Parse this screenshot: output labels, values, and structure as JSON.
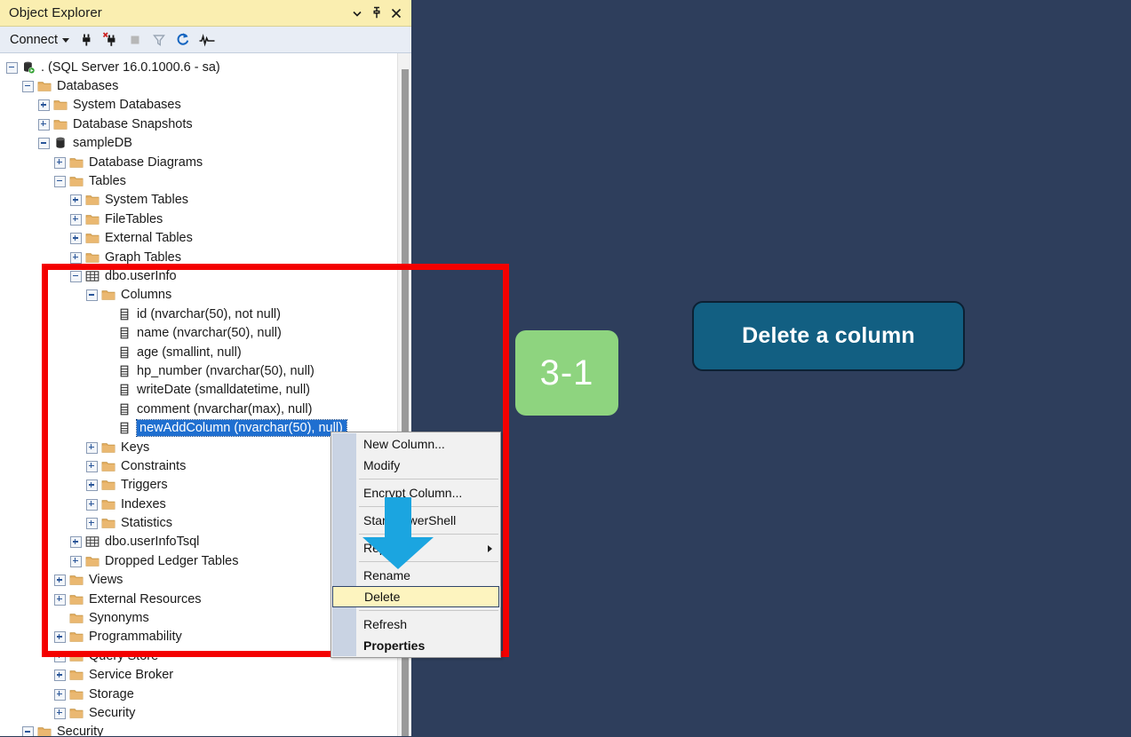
{
  "panel": {
    "title": "Object Explorer",
    "titlebar_buttons": [
      {
        "name": "dropdown-icon",
        "glyph": "▾"
      },
      {
        "name": "pin-icon",
        "glyph": "📌"
      },
      {
        "name": "close-icon",
        "glyph": "✕"
      }
    ],
    "toolbar": {
      "connect_label": "Connect",
      "icons": [
        "connect-icon",
        "disconnect-icon",
        "stop-icon",
        "filter-icon",
        "refresh-icon",
        "activity-monitor-icon"
      ]
    }
  },
  "tree": [
    {
      "label": ". (SQL Server 16.0.1000.6 - sa)",
      "depth": 0,
      "state": "minus",
      "icon": "server-icon"
    },
    {
      "label": "Databases",
      "depth": 1,
      "state": "minus",
      "icon": "folder-icon"
    },
    {
      "label": "System Databases",
      "depth": 2,
      "state": "plus",
      "icon": "folder-icon"
    },
    {
      "label": "Database Snapshots",
      "depth": 2,
      "state": "plus",
      "icon": "folder-icon"
    },
    {
      "label": "sampleDB",
      "depth": 2,
      "state": "minus",
      "icon": "database-icon"
    },
    {
      "label": "Database Diagrams",
      "depth": 3,
      "state": "plus",
      "icon": "folder-icon"
    },
    {
      "label": "Tables",
      "depth": 3,
      "state": "minus",
      "icon": "folder-icon"
    },
    {
      "label": "System Tables",
      "depth": 4,
      "state": "plus",
      "icon": "folder-icon"
    },
    {
      "label": "FileTables",
      "depth": 4,
      "state": "plus",
      "icon": "folder-icon"
    },
    {
      "label": "External Tables",
      "depth": 4,
      "state": "plus",
      "icon": "folder-icon"
    },
    {
      "label": "Graph Tables",
      "depth": 4,
      "state": "plus",
      "icon": "folder-icon"
    },
    {
      "label": "dbo.userInfo",
      "depth": 4,
      "state": "minus",
      "icon": "table-icon"
    },
    {
      "label": "Columns",
      "depth": 5,
      "state": "minus",
      "icon": "folder-icon"
    },
    {
      "label": "id (nvarchar(50), not null)",
      "depth": 6,
      "state": "none",
      "icon": "column-icon"
    },
    {
      "label": "name (nvarchar(50), null)",
      "depth": 6,
      "state": "none",
      "icon": "column-icon"
    },
    {
      "label": "age (smallint, null)",
      "depth": 6,
      "state": "none",
      "icon": "column-icon"
    },
    {
      "label": "hp_number (nvarchar(50), null)",
      "depth": 6,
      "state": "none",
      "icon": "column-icon"
    },
    {
      "label": "writeDate (smalldatetime, null)",
      "depth": 6,
      "state": "none",
      "icon": "column-icon"
    },
    {
      "label": "comment (nvarchar(max), null)",
      "depth": 6,
      "state": "none",
      "icon": "column-icon"
    },
    {
      "label": "newAddColumn (nvarchar(50), null)",
      "depth": 6,
      "state": "none",
      "icon": "column-icon",
      "selected": true
    },
    {
      "label": "Keys",
      "depth": 5,
      "state": "plus",
      "icon": "folder-icon"
    },
    {
      "label": "Constraints",
      "depth": 5,
      "state": "plus",
      "icon": "folder-icon"
    },
    {
      "label": "Triggers",
      "depth": 5,
      "state": "plus",
      "icon": "folder-icon"
    },
    {
      "label": "Indexes",
      "depth": 5,
      "state": "plus",
      "icon": "folder-icon"
    },
    {
      "label": "Statistics",
      "depth": 5,
      "state": "plus",
      "icon": "folder-icon"
    },
    {
      "label": "dbo.userInfoTsql",
      "depth": 4,
      "state": "plus",
      "icon": "table-icon"
    },
    {
      "label": "Dropped Ledger Tables",
      "depth": 4,
      "state": "plus",
      "icon": "folder-icon"
    },
    {
      "label": "Views",
      "depth": 3,
      "state": "plus",
      "icon": "folder-icon"
    },
    {
      "label": "External Resources",
      "depth": 3,
      "state": "plus",
      "icon": "folder-icon"
    },
    {
      "label": "Synonyms",
      "depth": 3,
      "state": "none",
      "icon": "folder-icon"
    },
    {
      "label": "Programmability",
      "depth": 3,
      "state": "plus",
      "icon": "folder-icon"
    },
    {
      "label": "Query Store",
      "depth": 3,
      "state": "plus",
      "icon": "folder-icon"
    },
    {
      "label": "Service Broker",
      "depth": 3,
      "state": "plus",
      "icon": "folder-icon"
    },
    {
      "label": "Storage",
      "depth": 3,
      "state": "plus",
      "icon": "folder-icon"
    },
    {
      "label": "Security",
      "depth": 3,
      "state": "plus",
      "icon": "folder-icon"
    },
    {
      "label": "Security",
      "depth": 1,
      "state": "minus",
      "icon": "folder-icon"
    }
  ],
  "context_menu": [
    {
      "label": "New Column...",
      "type": "item"
    },
    {
      "label": "Modify",
      "type": "item"
    },
    {
      "type": "separator"
    },
    {
      "label": "Encrypt Column...",
      "type": "item"
    },
    {
      "type": "separator"
    },
    {
      "label": "Start PowerShell",
      "type": "item"
    },
    {
      "type": "separator"
    },
    {
      "label": "Reports",
      "type": "submenu"
    },
    {
      "type": "separator"
    },
    {
      "label": "Rename",
      "type": "item"
    },
    {
      "label": "Delete",
      "type": "item",
      "highlighted": true
    },
    {
      "type": "separator"
    },
    {
      "label": "Refresh",
      "type": "item"
    },
    {
      "label": "Properties",
      "type": "item",
      "bold": true
    }
  ],
  "annotations": {
    "step_badge": "3-1",
    "action_button": "Delete a column",
    "arrow": "down-arrow-icon",
    "highlight_rect": "red-highlight-rect"
  },
  "colors": {
    "background": "#2e3e5c",
    "titlebar": "#faeeb0",
    "toolbar": "#e8edf5",
    "selection": "#1f6fd0",
    "highlight_rect": "#f40000",
    "menu_highlight": "#fdf4bf",
    "badge_green": "#8ed47f",
    "button_teal": "#125f82",
    "arrow_blue": "#1ba5e0"
  }
}
